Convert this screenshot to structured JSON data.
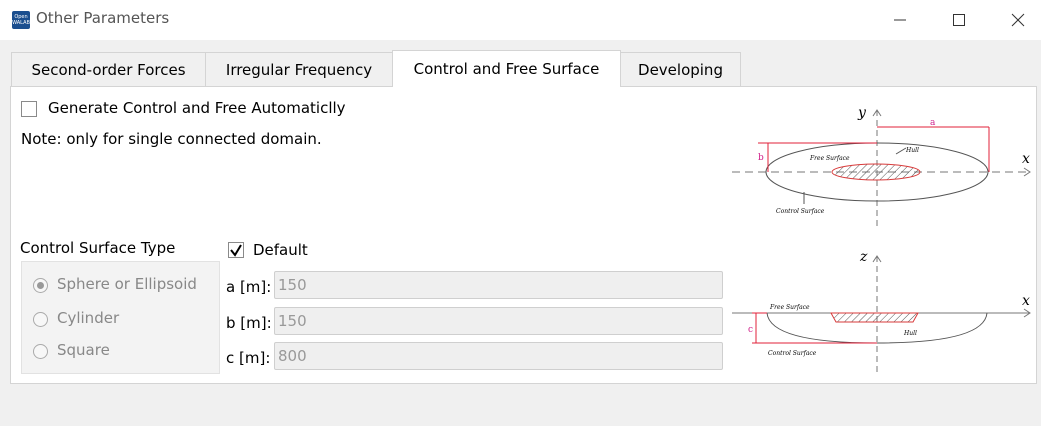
{
  "window": {
    "title": "Other Parameters",
    "icon_text": "Open WALAB"
  },
  "tabs": [
    {
      "label": "Second-order Forces",
      "active": false
    },
    {
      "label": "Irregular Frequency",
      "active": false
    },
    {
      "label": "Control and Free Surface",
      "active": true
    },
    {
      "label": "Developing",
      "active": false
    }
  ],
  "panel": {
    "auto_checkbox_label": "Generate Control and Free Automaticlly",
    "auto_checked": false,
    "note": "Note: only for single connected domain.",
    "control_surface_type_label": "Control Surface Type",
    "radio_options": [
      {
        "label": "Sphere or Ellipsoid",
        "selected": true
      },
      {
        "label": "Cylinder",
        "selected": false
      },
      {
        "label": "Square",
        "selected": false
      }
    ],
    "default_checkbox_label": "Default",
    "default_checked": true,
    "fields": [
      {
        "label": "a [m]:",
        "value": "150"
      },
      {
        "label": "b [m]:",
        "value": "150"
      },
      {
        "label": "c [m]:",
        "value": "800"
      }
    ]
  },
  "diagram_top": {
    "axis_y": "y",
    "axis_x": "x",
    "label_a": "a",
    "label_b": "b",
    "free_surface": "Free Surface",
    "hull": "Hull",
    "control_surface": "Control Surface"
  },
  "diagram_bottom": {
    "axis_z": "z",
    "axis_x": "x",
    "label_c": "c",
    "free_surface": "Free Surface",
    "hull": "Hull",
    "control_surface": "Control Surface"
  },
  "colors": {
    "dimension_line": "#e0203a",
    "dimension_label": "#d0208a",
    "hull_hatch": "#d83a3a"
  }
}
